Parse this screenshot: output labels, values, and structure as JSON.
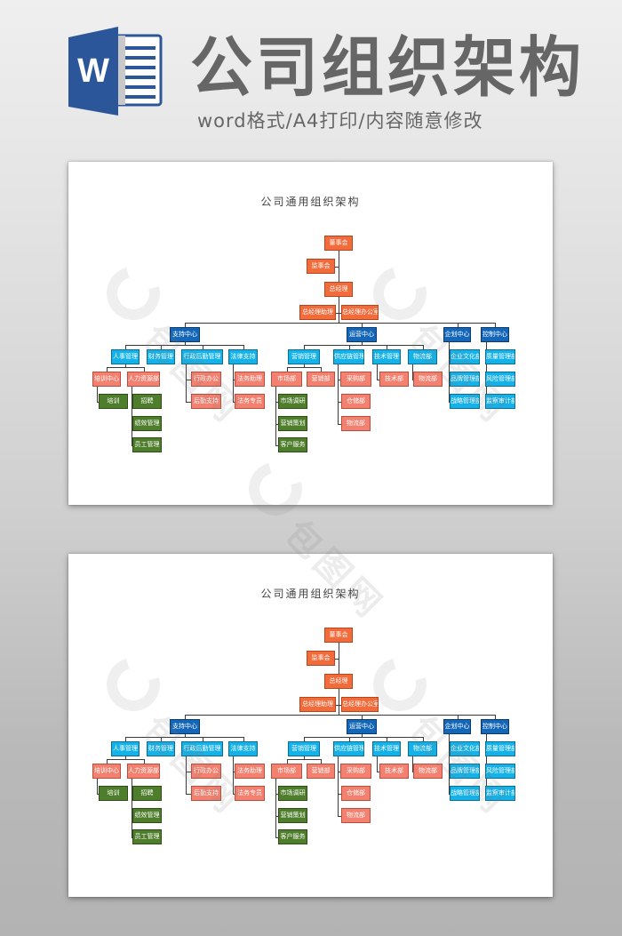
{
  "header": {
    "app_icon": "word-icon",
    "app_icon_letter": "W",
    "title": "公司组织架构",
    "subtitle": "word格式/A4打印/内容随意修改"
  },
  "colors": {
    "top_level": "#f26b3a",
    "center": "#1467b8",
    "level2": "#14b2e8",
    "level3": "#f4806f",
    "level4": "#4e7d2b"
  },
  "watermark": "包图网",
  "document": {
    "title": "公司通用组织架构",
    "pages": 2
  },
  "org_chart": {
    "top": [
      {
        "id": "board",
        "label": "董事会"
      },
      {
        "id": "supervisors",
        "label": "监事会"
      },
      {
        "id": "gm",
        "label": "总经理"
      },
      {
        "id": "gm_assistant",
        "label": "总经理助理"
      },
      {
        "id": "gm_office",
        "label": "总经理办公室"
      }
    ],
    "centers": [
      {
        "id": "support",
        "label": "支持中心",
        "children": [
          {
            "id": "hr",
            "label": "人事管理",
            "children": [
              {
                "id": "training_center",
                "label": "培训中心",
                "children": [
                  {
                    "id": "training",
                    "label": "培训"
                  }
                ]
              },
              {
                "id": "hr_dept",
                "label": "人力资源部",
                "children": [
                  {
                    "id": "recruit",
                    "label": "招聘"
                  },
                  {
                    "id": "perf",
                    "label": "绩效管理"
                  },
                  {
                    "id": "staff",
                    "label": "员工管理"
                  }
                ]
              }
            ]
          },
          {
            "id": "finance",
            "label": "财务管理",
            "children": []
          },
          {
            "id": "admin",
            "label": "行政后勤管理",
            "children": [
              {
                "id": "admin_office",
                "label": "行政办公",
                "children": []
              },
              {
                "id": "logistics_support",
                "label": "后勤支持",
                "children": []
              }
            ]
          },
          {
            "id": "legal",
            "label": "法律支持",
            "children": [
              {
                "id": "legal_assistant",
                "label": "法务助理",
                "children": []
              },
              {
                "id": "legal_specialist",
                "label": "法务专员",
                "children": []
              }
            ]
          }
        ]
      },
      {
        "id": "operations",
        "label": "运营中心",
        "children": [
          {
            "id": "marketing_mgmt",
            "label": "营销管理",
            "children": [
              {
                "id": "market_dept",
                "label": "市场部",
                "children": [
                  {
                    "id": "market_research",
                    "label": "市场调研"
                  },
                  {
                    "id": "marketing_plan",
                    "label": "营销策划"
                  },
                  {
                    "id": "customer_service",
                    "label": "客户服务"
                  }
                ]
              },
              {
                "id": "sales_dept",
                "label": "营销部",
                "children": []
              }
            ]
          },
          {
            "id": "supply_chain",
            "label": "供应链管理",
            "children": [
              {
                "id": "purchasing",
                "label": "采购部",
                "children": []
              },
              {
                "id": "warehouse",
                "label": "仓储部",
                "children": []
              },
              {
                "id": "logistics_dept",
                "label": "物流部",
                "children": []
              }
            ]
          },
          {
            "id": "tech_mgmt",
            "label": "技术管理",
            "children": [
              {
                "id": "tech_dept",
                "label": "技术部",
                "children": []
              }
            ]
          },
          {
            "id": "logistics",
            "label": "物流部",
            "children": [
              {
                "id": "logistics_dept2",
                "label": "物流部",
                "children": []
              }
            ]
          }
        ]
      },
      {
        "id": "planning",
        "label": "企划中心",
        "children": [
          {
            "id": "culture",
            "label": "企业文化部",
            "children": []
          },
          {
            "id": "brand",
            "label": "品牌管理部",
            "children": []
          },
          {
            "id": "strategy",
            "label": "战略管理部",
            "children": []
          }
        ]
      },
      {
        "id": "control",
        "label": "控制中心",
        "children": [
          {
            "id": "quality",
            "label": "质量管理部",
            "children": []
          },
          {
            "id": "risk",
            "label": "风险管理部",
            "children": []
          },
          {
            "id": "audit",
            "label": "监察审计部",
            "children": []
          }
        ]
      }
    ]
  }
}
